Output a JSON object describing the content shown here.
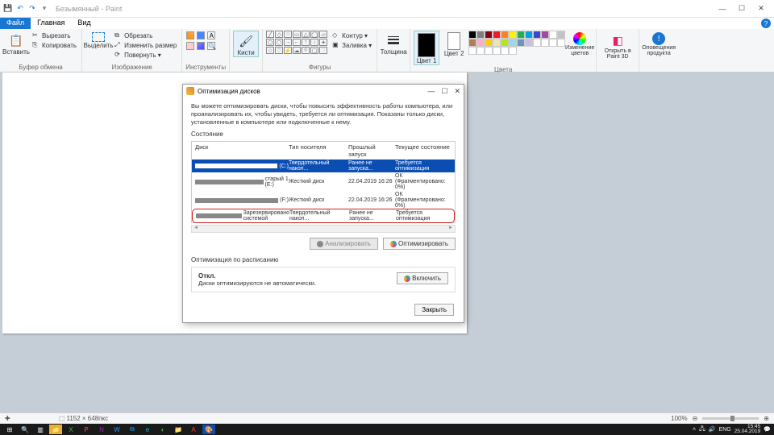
{
  "titlebar": {
    "title": "Безымянный - Paint"
  },
  "tabs": {
    "file": "Файл",
    "home": "Главная",
    "view": "Вид"
  },
  "ribbon": {
    "clipboard": {
      "label": "Буфер обмена",
      "paste": "Вставить",
      "cut": "Вырезать",
      "copy": "Копировать"
    },
    "image": {
      "label": "Изображение",
      "select": "Выделить",
      "crop": "Обрезать",
      "resize": "Изменить размер",
      "rotate": "Повернуть ▾"
    },
    "tools": {
      "label": "Инструменты"
    },
    "brushes": {
      "label": "Кисти"
    },
    "shapes": {
      "label": "Фигуры",
      "outline": "Контур ▾",
      "fill": "Заливка ▾"
    },
    "size": {
      "label": "Толщина"
    },
    "colors": {
      "label": "Цвета",
      "c1": "Цвет 1",
      "c2": "Цвет 2",
      "edit": "Изменение цветов"
    },
    "paint3d": {
      "label": "Открыть в Paint 3D"
    },
    "alerts": {
      "label": "Оповещения продукта"
    }
  },
  "palette_colors": [
    "#000",
    "#7f7f7f",
    "#880015",
    "#ed1c24",
    "#ff7f27",
    "#fff200",
    "#22b14c",
    "#00a2e8",
    "#3f48cc",
    "#a349a4",
    "#fff",
    "#c3c3c3",
    "#b97a57",
    "#ffaec9",
    "#ffc90e",
    "#efe4b0",
    "#b5e61d",
    "#99d9ea",
    "#7092be",
    "#c8bfe7"
  ],
  "dialog": {
    "title": "Оптимизация дисков",
    "desc": "Вы можете оптимизировать диски, чтобы повысить эффективность работы компьютера, или проанализировать их, чтобы увидеть, требуется ли оптимизация. Показаны только диски, установленные в компьютере или подключенные к нему.",
    "section_state": "Состояние",
    "columns": {
      "disk": "Диск",
      "type": "Тип носителя",
      "last": "Прошлый запуск",
      "status": "Текущее состояние"
    },
    "rows": [
      {
        "name": "(C:)",
        "type": "Твердотельный накоп...",
        "last": "Ранее не запуска...",
        "status": "Требуется оптимизация",
        "selected": true
      },
      {
        "name": "старый 1 (E:)",
        "type": "Жесткий диск",
        "last": "22.04.2019 16:26",
        "status": "ОК (Фрагментировано: 0%)"
      },
      {
        "name": "(F:)",
        "type": "Жесткий диск",
        "last": "22.04.2019 16:26",
        "status": "ОК (Фрагментировано: 0%)"
      },
      {
        "name": "Зарезервировано системой",
        "type": "Твердотельный накоп...",
        "last": "Ранее не запуска...",
        "status": "Требуется оптимизация",
        "highlight": true
      }
    ],
    "analyze": "Анализировать",
    "optimize": "Оптимизировать",
    "section_schedule": "Оптимизация по расписанию",
    "schedule_off": "Откл.",
    "schedule_desc": "Диски оптимизируются не автоматически.",
    "enable": "Включить",
    "close": "Закрыть"
  },
  "statusbar": {
    "pos": "✚",
    "size": "⬚  1152 × 648пкс",
    "zoom": "100%"
  },
  "taskbar": {
    "lang": "ENG",
    "clock_time": "15:45",
    "clock_date": "25.04.2019"
  }
}
